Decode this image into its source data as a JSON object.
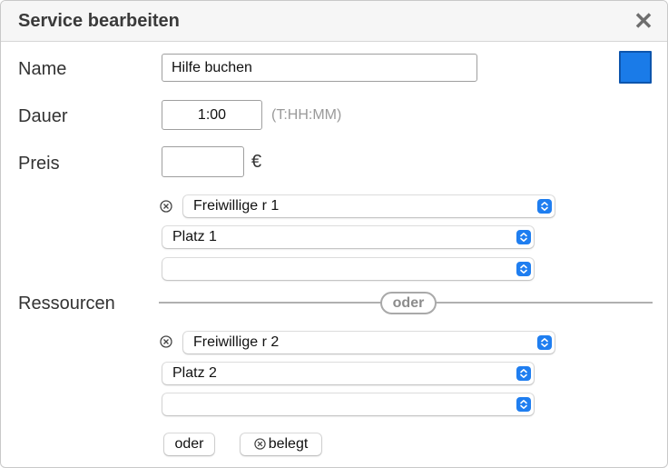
{
  "dialog": {
    "title": "Service bearbeiten",
    "close_glyph": "✕"
  },
  "name": {
    "label": "Name",
    "value": "Hilfe buchen",
    "color": "#1a7be8"
  },
  "dauer": {
    "label": "Dauer",
    "value": "1:00",
    "hint": "(T:HH:MM)"
  },
  "preis": {
    "label": "Preis",
    "value": "",
    "currency": "€"
  },
  "ressourcen": {
    "label": "Ressourcen",
    "separator": "oder",
    "groups": [
      {
        "resource": "Freiwillige r 1",
        "place": "Platz 1",
        "extra": ""
      },
      {
        "resource": "Freiwillige r 2",
        "place": "Platz 2",
        "extra": ""
      }
    ],
    "add_or_label": "oder",
    "busy_label": "belegt"
  },
  "icons": {
    "remove": "circle-x-icon",
    "close": "close-icon",
    "chevron": "up-down-chevron-icon"
  }
}
